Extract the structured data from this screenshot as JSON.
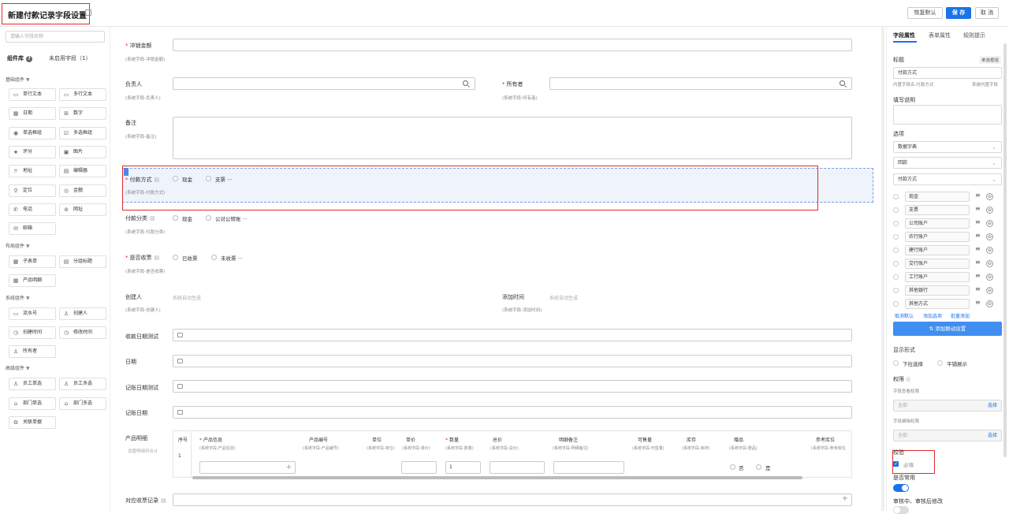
{
  "header": {
    "title": "新建付款记录字段设置",
    "restore_label": "恢复默认",
    "save_label": "保 存",
    "cancel_label": "取 消"
  },
  "left": {
    "search_placeholder": "请输入字段名称",
    "tab_library": "组件库",
    "tab_unused": "未启用字段（1）",
    "groups": {
      "basic": "基础组件",
      "layout": "布局组件",
      "system": "系统组件",
      "advanced": "高级组件"
    },
    "basic": [
      "单行文本",
      "多行文本",
      "日期",
      "数字",
      "单选框组",
      "多选框组",
      "评分",
      "图片",
      "地址",
      "编辑器",
      "定位",
      "金额",
      "电话",
      "网址",
      "邮箱"
    ],
    "layout": [
      "子表单",
      "分组标题",
      "产品明细"
    ],
    "system": [
      "流水号",
      "创建人",
      "创建时间",
      "修改时间",
      "所有者"
    ],
    "advanced": [
      "员工单选",
      "员工多选",
      "部门单选",
      "部门多选",
      "关联单据"
    ]
  },
  "form": {
    "offset_amount": {
      "label": "冲销金额",
      "sub": "(系统字段-冲销金额)"
    },
    "owner_person": {
      "label": "负责人",
      "sub": "(系统字段-负责人)"
    },
    "owner": {
      "label": "所有者",
      "sub": "(系统字段-所有者)"
    },
    "remark": {
      "label": "备注",
      "sub": "(系统字段-备注)"
    },
    "pay_method": {
      "label": "付款方式",
      "sub": "(系统字段-付款方式)",
      "opt1": "现金",
      "opt2": "支票 ···"
    },
    "pay_category": {
      "label": "付款分类",
      "sub": "(系统字段-付款分类)",
      "opt1": "现金",
      "opt2": "公对公转账 ···"
    },
    "received": {
      "label": "是否收票",
      "sub": "(系统字段-是否收票)",
      "opt1": "已收票",
      "opt2": "未收票 ···"
    },
    "creator": {
      "label": "创建人",
      "sub": "(系统字段-创建人)",
      "value": "系统自动生成"
    },
    "add_time": {
      "label": "添加时间",
      "sub": "(系统字段-添加时间)",
      "value": "系统自动生成"
    },
    "receive_date_test": {
      "label": "收款日期测试"
    },
    "date": {
      "label": "日期"
    },
    "book_date_test": {
      "label": "记账日期测试"
    },
    "book_date": {
      "label": "记账日期"
    },
    "product_detail": {
      "label": "产品明细",
      "hint": "设置明细列合计"
    },
    "receive_record": {
      "label": "对应收票记录"
    }
  },
  "table": {
    "headers": [
      {
        "label": "序号",
        "sub": ""
      },
      {
        "label": "产品信息",
        "sub": "(系统字段-产品信息)",
        "req": true
      },
      {
        "label": "产品编号",
        "sub": "(系统字段-产品编号)"
      },
      {
        "label": "单位",
        "sub": "(系统字段-单位)"
      },
      {
        "label": "单价",
        "sub": "(系统字段-单价)"
      },
      {
        "label": "数量",
        "sub": "(系统字段-数量)",
        "req": true
      },
      {
        "label": "总价",
        "sub": "(系统字段-总价)"
      },
      {
        "label": "明细备注",
        "sub": "(系统字段-明细备注)"
      },
      {
        "label": "可售量",
        "sub": "(系统字段-可售量)"
      },
      {
        "label": "库存",
        "sub": "(系统字段-库存)"
      },
      {
        "label": "赠品",
        "sub": "(系统字段-赠品)"
      },
      {
        "label": "参考库位",
        "sub": "(系统字段-参考库位"
      }
    ],
    "row_index": "1",
    "qty_value": "1",
    "gift_no": "否",
    "gift_yes": "是"
  },
  "right": {
    "tab_field": "字段属性",
    "tab_form": "表单属性",
    "tab_rules": "规则提示",
    "title_label": "标题",
    "title_badge": "单选框组",
    "title_value": "付款方式",
    "built_in_name": "内置字段名:付款方式",
    "system_field": "系统内置字段",
    "desc_label": "填写说明",
    "options_label": "选项",
    "source_value": "数据字典",
    "source2_value": "回款",
    "source3_value": "付款方式",
    "options": [
      "现金",
      "支票",
      "公司账户",
      "农行账户",
      "建行账户",
      "交行账户",
      "工行账户",
      "其他银行",
      "其他方式"
    ],
    "cancel_default": "取消默认",
    "add_option": "添加选项",
    "batch_add": "批量添加",
    "add_linkage": "⇅ 添加联动设置",
    "display_label": "显示形式",
    "display_dropdown": "下拉选择",
    "display_flat": "平铺展示",
    "perm_label": "权限",
    "view_perm": "字段查看权限",
    "view_value": "全部",
    "select_label": "选择",
    "edit_perm": "字段编辑权限",
    "edit_value": "全部",
    "validate_label": "校验",
    "required_label": "必填",
    "common_label": "是否常用",
    "audit_label": "审核中、审核后修改"
  }
}
